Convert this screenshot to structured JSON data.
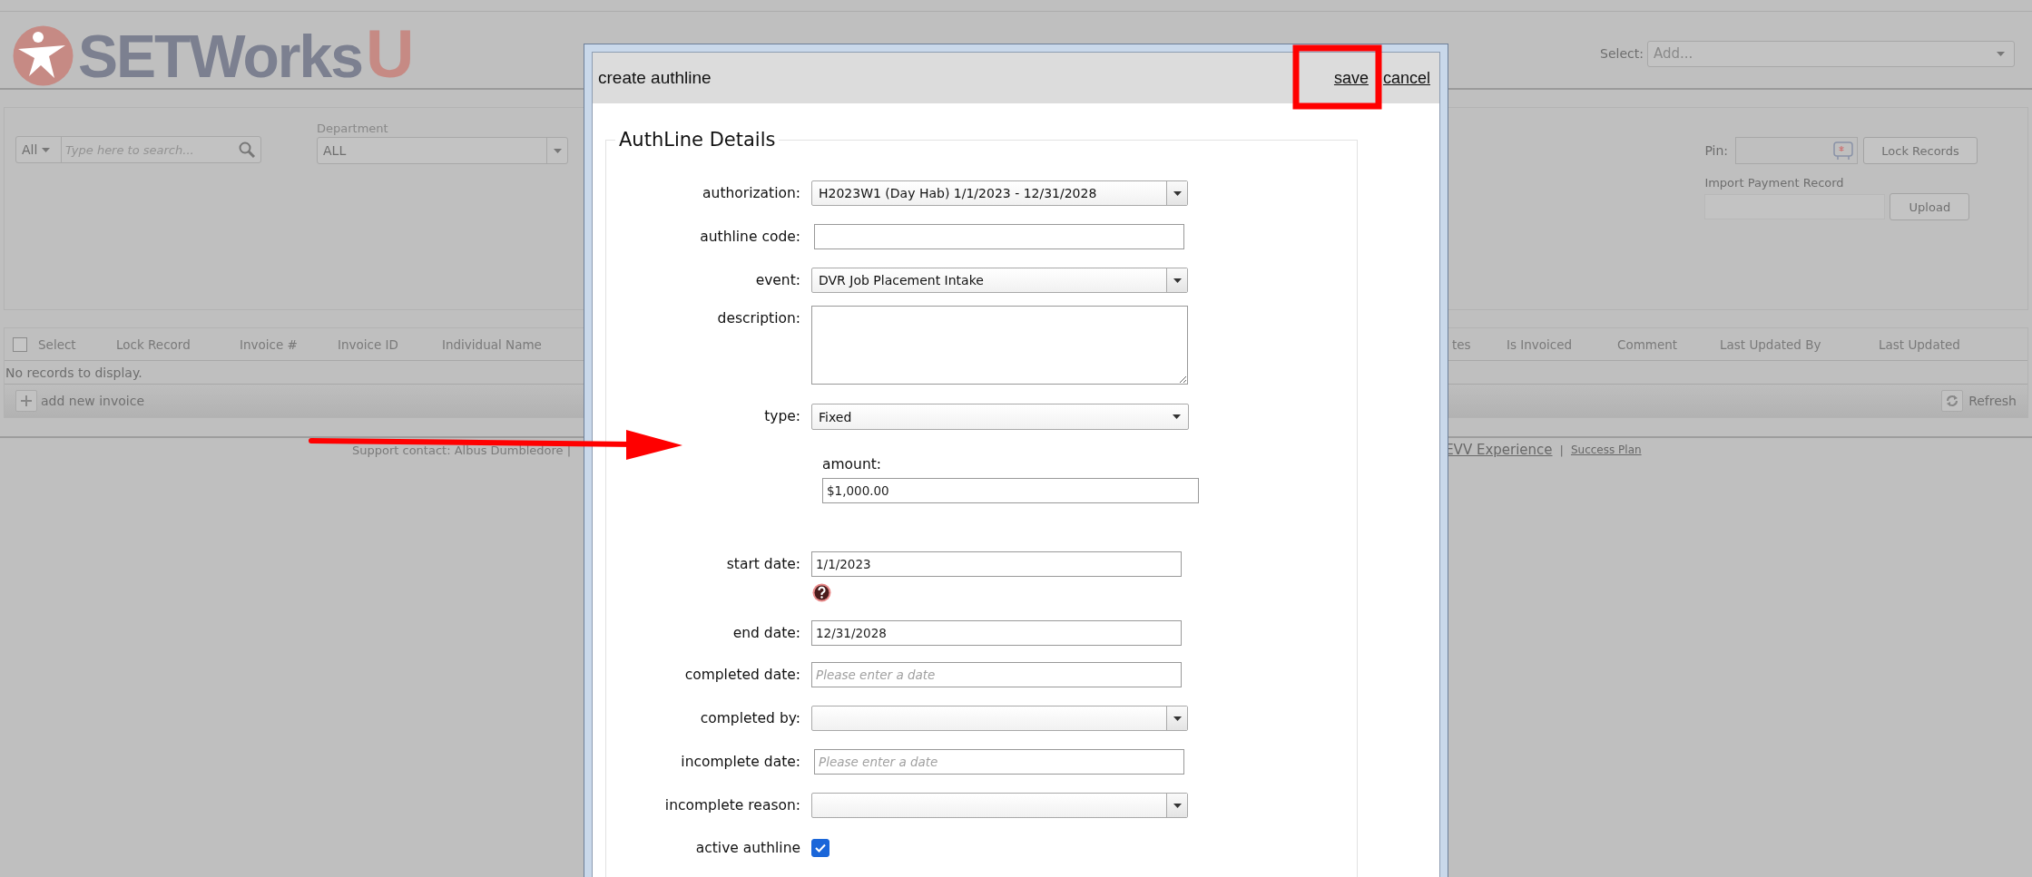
{
  "header": {
    "logo": {
      "name": "SETWorks",
      "accent": "U"
    },
    "select": {
      "label": "Select:",
      "placeholder": "Add..."
    }
  },
  "filters": {
    "search_scope": "All",
    "search": {
      "placeholder": "Type here to search..."
    },
    "department": {
      "label": "Department",
      "value": "ALL"
    },
    "pin": {
      "label": "Pin:"
    },
    "lock_button": "Lock Records",
    "import": {
      "label": "Import Payment Record"
    },
    "upload_button": "Upload"
  },
  "grid": {
    "select_all": {
      "label": "Select",
      "checked": false
    },
    "columns_left": [
      "Lock Record",
      "Invoice #",
      "Invoice ID",
      "Individual Name"
    ],
    "columns_right": [
      "tes",
      "Is Invoiced",
      "Comment",
      "Last Updated By",
      "Last Updated"
    ],
    "empty": "No records to display.",
    "add": "add new invoice",
    "refresh": "Refresh"
  },
  "footer": {
    "left": "Support contact: Albus Dumbledore |",
    "links": [
      {
        "text": "EVV Experience",
        "kind": "link"
      },
      {
        "text": "|",
        "kind": "sep"
      },
      {
        "text": "Success Plan",
        "kind": "small-link"
      }
    ]
  },
  "modal": {
    "title": "create authline",
    "actions": [
      "save",
      "cancel"
    ],
    "section": "AuthLine Details",
    "fields": [
      {
        "kind": "select",
        "label": "authorization:",
        "value": "H2023W1 (Day Hab) 1/1/2023 - 12/31/2028"
      },
      {
        "kind": "text",
        "label": "authline code:"
      },
      {
        "kind": "select",
        "label": "event:",
        "value": "DVR Job Placement Intake"
      },
      {
        "kind": "textarea",
        "label": "description:"
      },
      {
        "kind": "plain-select",
        "label": "type:",
        "value": "Fixed"
      },
      {
        "kind": "stacked",
        "label": "amount:",
        "value": "$1,000.00"
      },
      {
        "kind": "text",
        "label": "start date:",
        "value": "1/1/2023",
        "help": true
      },
      {
        "kind": "text",
        "label": "end date:",
        "value": "12/31/2028"
      },
      {
        "kind": "text",
        "label": "completed date:",
        "placeholder": "Please enter a date"
      },
      {
        "kind": "select",
        "label": "completed by:"
      },
      {
        "kind": "text",
        "label": "incomplete date:",
        "placeholder": "Please enter a date"
      },
      {
        "kind": "select",
        "label": "incomplete reason:"
      },
      {
        "kind": "checkbox",
        "label": "active authline",
        "checked": true
      }
    ]
  }
}
